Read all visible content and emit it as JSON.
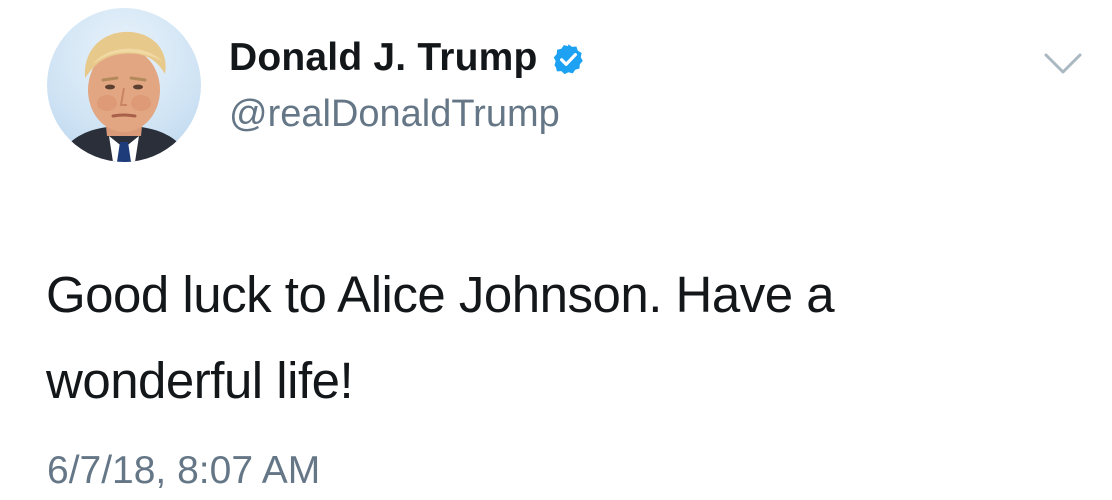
{
  "tweet": {
    "author": {
      "display_name": "Donald J. Trump",
      "handle": "@realDonaldTrump",
      "verified": true
    },
    "text": "Good luck to Alice Johnson. Have a wonderful life!",
    "timestamp": "6/7/18, 8:07 AM"
  },
  "icons": {
    "verified": "verified-badge-icon",
    "menu": "chevron-down-icon"
  },
  "colors": {
    "verified_blue": "#1da1f2",
    "secondary_text": "#657786",
    "primary_text": "#14171a",
    "caret": "#aab8c2"
  }
}
